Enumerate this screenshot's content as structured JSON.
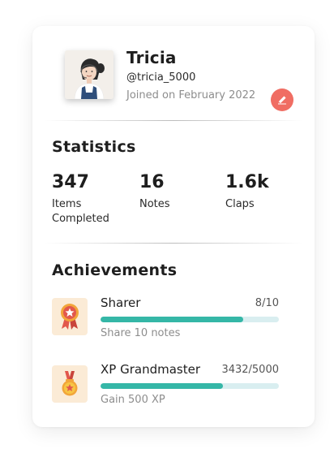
{
  "profile": {
    "name": "Tricia",
    "handle": "@tricia_5000",
    "joined": "Joined on February 2022"
  },
  "statistics": {
    "title": "Statistics",
    "items": [
      {
        "value": "347",
        "label": "Items Completed"
      },
      {
        "value": "16",
        "label": "Notes"
      },
      {
        "value": "1.6k",
        "label": "Claps"
      }
    ]
  },
  "achievements": {
    "title": "Achievements",
    "items": [
      {
        "icon": "ribbon-badge-icon",
        "title": "Sharer",
        "progress": "8/10",
        "fraction": 0.8,
        "description": "Share 10 notes"
      },
      {
        "icon": "medal-icon",
        "title": "XP Grandmaster",
        "progress": "3432/5000",
        "fraction": 0.6864,
        "description": "Gain 500 XP"
      }
    ]
  },
  "colors": {
    "accent": "#35b7a7",
    "track": "#d9eef0",
    "edit_button": "#f06d63",
    "icon_background": "#fbebd6"
  }
}
